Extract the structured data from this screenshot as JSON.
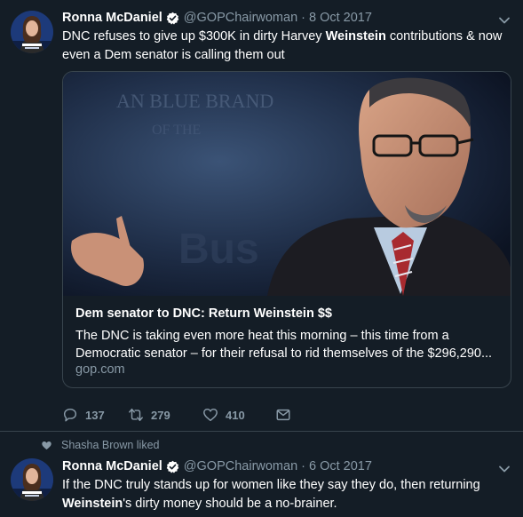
{
  "tweets": [
    {
      "author_name": "Ronna McDaniel",
      "handle": "@GOPChairwoman",
      "date": "8 Oct 2017",
      "text_parts": {
        "before": "DNC refuses to give up $300K in dirty Harvey ",
        "bold": "Weinstein",
        "after": " contributions & now even a Dem senator is calling them out"
      },
      "card": {
        "title": "Dem senator to DNC: Return Weinstein $$",
        "description": "The DNC is taking even more heat this morning – this time from a Democratic senator – for their refusal to rid themselves of the $296,290...",
        "domain": "gop.com",
        "image_icon": "photo-speaker-at-podium"
      },
      "stats": {
        "replies": "137",
        "retweets": "279",
        "likes": "410"
      }
    },
    {
      "social_context": "Shasha Brown liked",
      "author_name": "Ronna McDaniel",
      "handle": "@GOPChairwoman",
      "date": "6 Oct 2017",
      "text_parts": {
        "line1": "If the DNC truly stands up for women like they say they do, then returning",
        "bold": "Weinstein",
        "after": "'s dirty money should be a no-brainer."
      }
    }
  ],
  "colors": {
    "background": "#141d26",
    "secondary_text": "#8899a6",
    "border": "#38444d",
    "verified_badge": "#ffffff"
  },
  "icons": {
    "verified": "verified-badge-icon",
    "caret": "chevron-down-icon",
    "reply": "reply-icon",
    "retweet": "retweet-icon",
    "like": "heart-icon",
    "dm": "envelope-icon",
    "liked_context": "heart-icon"
  }
}
